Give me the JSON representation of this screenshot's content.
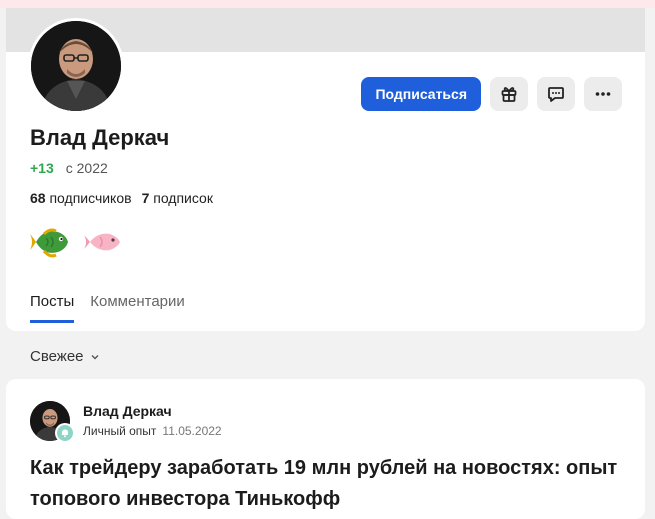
{
  "profile": {
    "name": "Влад Деркач",
    "rating": "+13",
    "since": "с 2022",
    "followers_count": "68",
    "followers_label": "подписчиков",
    "following_count": "7",
    "following_label": "подписок",
    "badges": [
      "fish-green-badge-icon",
      "fish-pink-badge-icon"
    ]
  },
  "actions": {
    "subscribe_label": "Подписаться",
    "gift_icon": "gift-icon",
    "message_icon": "message-icon",
    "more_icon": "more-icon"
  },
  "tabs": [
    {
      "label": "Посты",
      "active": true
    },
    {
      "label": "Комментарии",
      "active": false
    }
  ],
  "sort": {
    "label": "Свежее"
  },
  "post": {
    "author": "Влад Деркач",
    "category": "Личный опыт",
    "date": "11.05.2022",
    "title": "Как трейдеру заработать 19 млн рублей на новостях: опыт топового инвестора Тинькофф"
  },
  "colors": {
    "accent": "#1f5fdc",
    "rating": "#2fa84f",
    "background": "#f2f2f2",
    "top_strip": "#fde8ec"
  }
}
